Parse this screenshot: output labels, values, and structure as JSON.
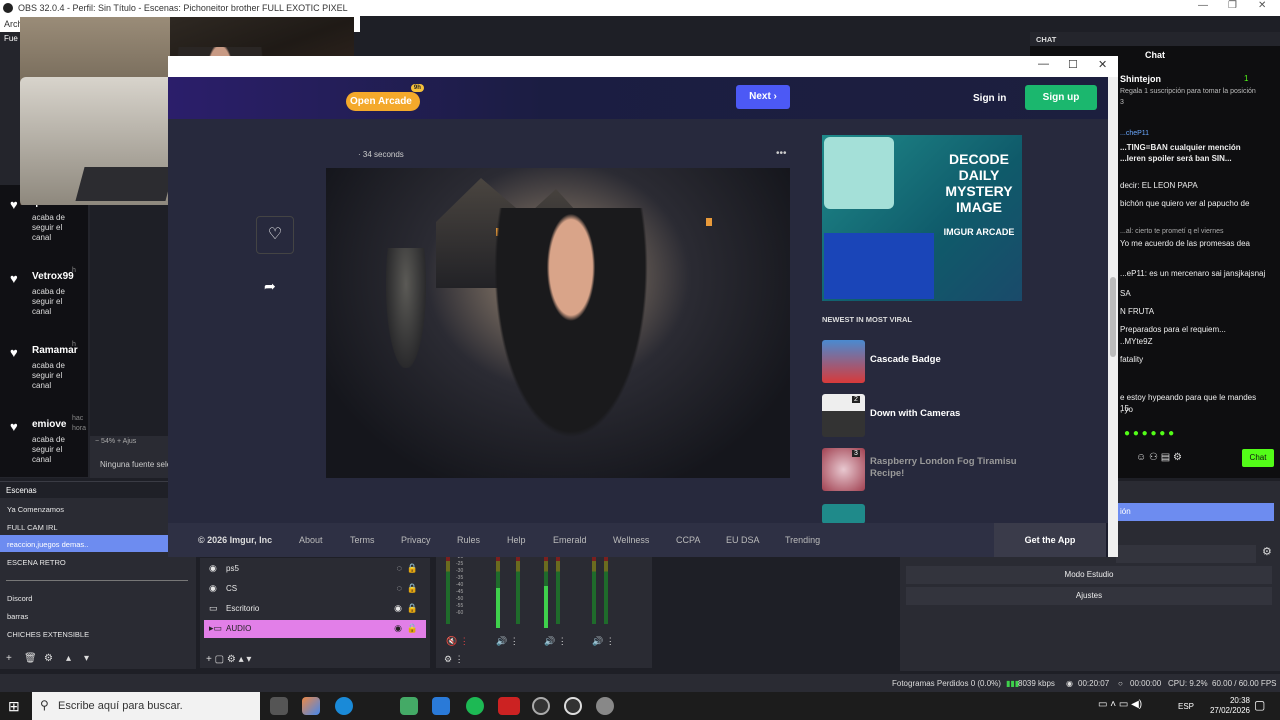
{
  "obs": {
    "title": "OBS 32.0.4 - Perfil: Sin Título - Escenas: Pichoneitor brother FULL EXOTIC PIXEL",
    "menu": "Arch",
    "sources_dock": "Fue",
    "zoom": "54%",
    "zoom_label": "Ajus",
    "no_source": "Ninguna fuente selec",
    "scenes_header": "Escenas",
    "scenes": [
      "Ya Comenzamos",
      "FULL CAM IRL",
      "reaccion,juegos demas..",
      "ESCENA RETRO",
      "Discord",
      "barras",
      "CHICHES EXTENSIBLE"
    ],
    "sources": [
      "ps5",
      "CS",
      "Escritorio",
      "AUDIO"
    ],
    "controls": [
      "Modo Estudio",
      "Ajustes"
    ],
    "controls_partial": "ión",
    "status": {
      "frames": "Fotogramas Perdidos 0 (0.0%)",
      "bitrate": "8039 kbps",
      "stream_time": "00:20:07",
      "rec_time": "00:00:00",
      "cpu": "CPU: 9.2%",
      "fps": "60.00 / 60.00 FPS"
    },
    "mixer_scale": [
      "-20",
      "-25",
      "-30",
      "-35",
      "-40",
      "-45",
      "-50",
      "-55",
      "-60"
    ]
  },
  "alerts": [
    {
      "name": "quiero...",
      "ago": "",
      "desc": "acaba de seguir el canal"
    },
    {
      "name": "Vetrox99",
      "ago": "h",
      "desc": "acaba de seguir el canal"
    },
    {
      "name": "Ramamar",
      "ago": "h",
      "desc": "acaba de seguir el canal"
    },
    {
      "name": "emiove",
      "ago": "hac",
      "desc": "acaba de seguir el canal"
    }
  ],
  "alerts_ago_last": "hora",
  "chat": {
    "panel": "CHAT",
    "title": "Chat",
    "pinned_user": "Shintejon",
    "pinned_text": "Regala 1 suscripción para tomar la posición 3",
    "pinned_count": "1",
    "pin_user": "...cheP11",
    "pin_text": "...TING=BAN cualquier mención ...leren spoiler será ban SIN...",
    "messages": [
      "decir: EL LEON PAPA",
      "bichón que quiero ver al papucho de",
      "...al: cierto te prometí q el viernes",
      "Yo me acuerdo de las promesas dea",
      "...eP11: es un mercenaro sai jansjkajsnaj",
      "SA",
      "N FRUTA",
      "Preparados para el requiem...",
      "..MYte9Z",
      "fatality",
      "e estoy hypeando para que le mandes 15",
      ", yo"
    ],
    "send": "Chat"
  },
  "browser": {
    "arcade": "Open Arcade",
    "arcade_badge": "9h",
    "next": "Next",
    "signin": "Sign in",
    "signup": "Sign up",
    "post_time": "34 seconds",
    "ad": {
      "title": "DECODE DAILY MYSTERY IMAGE",
      "brand": "IMGUR ARCADE"
    },
    "viral_header": "NEWEST IN MOST VIRAL",
    "viral": [
      {
        "label": "Cascade Badge",
        "count": ""
      },
      {
        "label": "Down with Cameras",
        "count": "2"
      },
      {
        "label": "Raspberry London Fog Tiramisu Recipe!",
        "count": "3"
      }
    ],
    "footer": [
      "© 2026 Imgur, Inc",
      "About",
      "Terms",
      "Privacy",
      "Rules",
      "Help",
      "Emerald",
      "Wellness",
      "CCPA",
      "EU DSA",
      "Trending"
    ],
    "get_app": "Get the App"
  },
  "taskbar": {
    "search": "Escribe aquí para buscar.",
    "lang": "ESP",
    "time": "20:38",
    "date": "27/02/2026"
  }
}
